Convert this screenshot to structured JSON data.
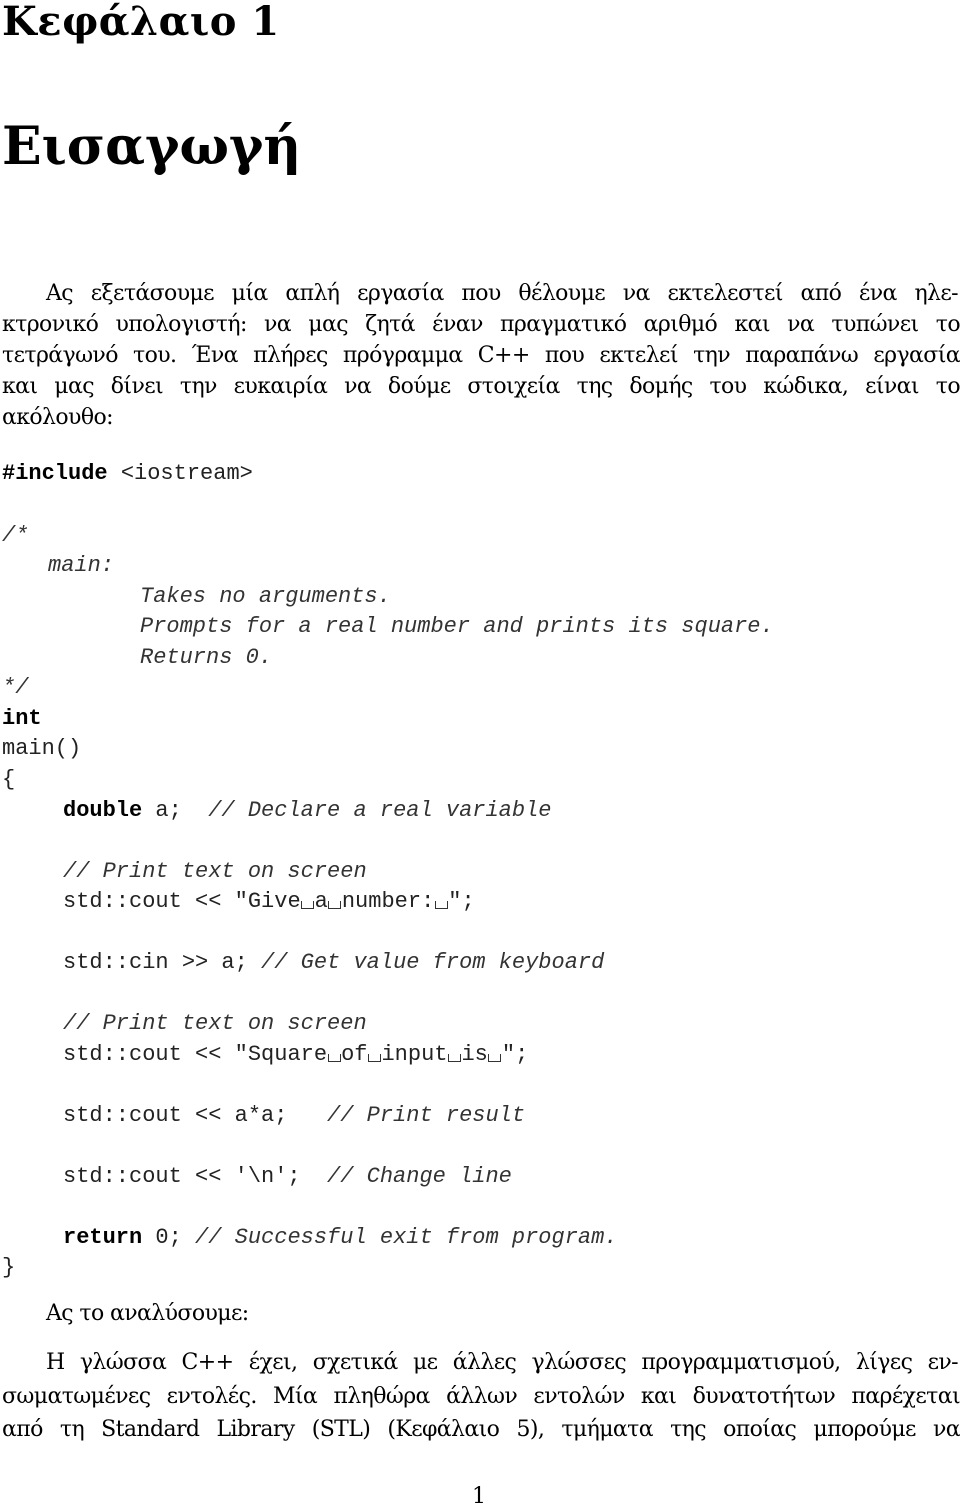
{
  "chapter": {
    "label": "Κεφάλαιο 1",
    "title": "Εισαγωγή"
  },
  "intro_paragraph": {
    "lines": [
      "Ας εξετάσουμε μία απλή εργασία που θέλουμε να εκτελεστεί από ένα ηλε-",
      "κτρονικό υπολογιστή: να μας ζητά έναν πραγματικό αριθμό και να τυπώνει το",
      "τετράγωνό του. Ένα πλήρες πρόγραμμα C++ που εκτελεί την παραπάνω εργασία",
      "και μας δίνει την ευκαιρία να δούμε στοιχεία της δομής του κώδικα, είναι το",
      "ακόλουθο:"
    ]
  },
  "code_listing": {
    "include_keyword": "#include",
    "include_header": "<iostream>",
    "comment_open": "/*",
    "comment_func": "main:",
    "comment_lines": [
      "Takes no arguments.",
      "Prompts for a real number and prints its square.",
      "Returns 0."
    ],
    "comment_close": "*/",
    "return_type": "int",
    "func_signature": "main()",
    "brace_open": "{",
    "decl_keyword": "double",
    "decl_rest": "a;",
    "decl_comment": "// Declare a real variable",
    "print_comment_1": "// Print text on screen",
    "cout_prefix": "std::cout << ",
    "string_1_words": [
      "Give",
      "a",
      "number:"
    ],
    "cin_stmt": "std::cin >> a;",
    "cin_comment": "// Get value from keyboard",
    "print_comment_2": "// Print text on screen",
    "string_2_words": [
      "Square",
      "of",
      "input",
      "is"
    ],
    "result_stmt": "std::cout << a*a;",
    "result_comment": "// Print result",
    "newline_stmt": "std::cout << '\\n';",
    "newline_comment": "// Change line",
    "return_keyword": "return",
    "return_rest": "0;",
    "return_comment": "// Successful exit from program.",
    "brace_close": "}"
  },
  "analysis_heading": "Ας το αναλύσουμε:",
  "closing_paragraph": {
    "lines": [
      "Η γλώσσα C++ έχει, σχετικά με άλλες γλώσσες προγραμματισμού, λίγες εν-",
      "σωματωμένες εντολές. Μία πληθώρα άλλων εντολών και δυνατοτήτων παρέχεται",
      "από τη Standard Library (STL) (Κεφάλαιο 5), τμήματα της οποίας μπορούμε να"
    ]
  },
  "page_number": "1"
}
